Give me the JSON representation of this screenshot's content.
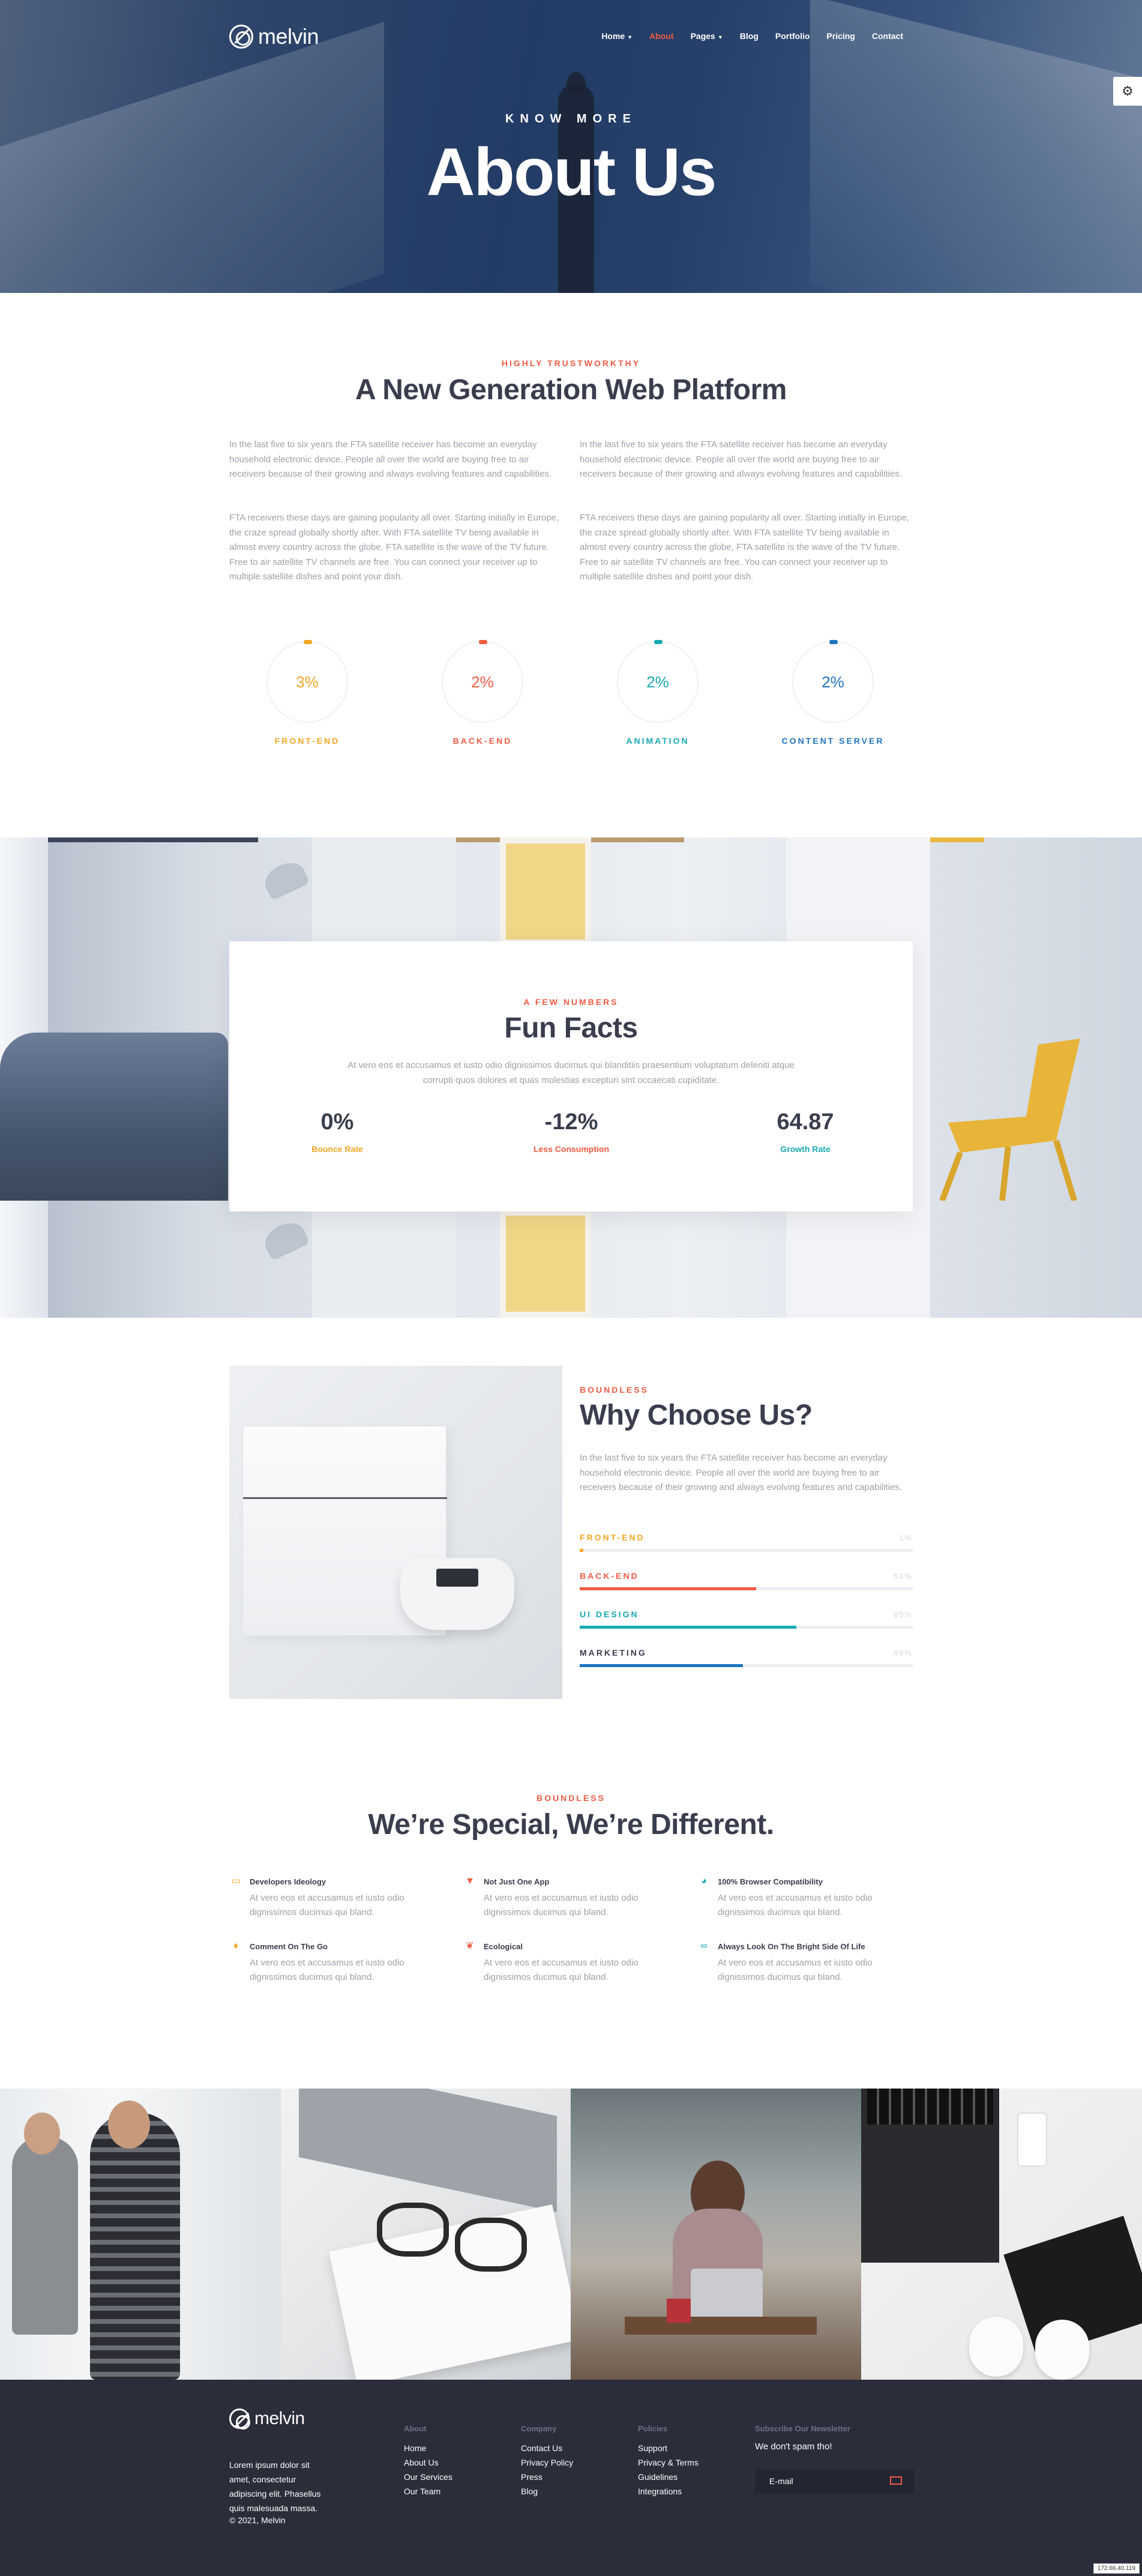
{
  "header": {
    "logo_text": "melvin",
    "nav": [
      {
        "label": "Home",
        "has_caret": true
      },
      {
        "label": "About",
        "active": true
      },
      {
        "label": "Pages",
        "has_caret": true
      },
      {
        "label": "Blog"
      },
      {
        "label": "Portfolio"
      },
      {
        "label": "Pricing"
      },
      {
        "label": "Contact"
      }
    ]
  },
  "hero": {
    "kicker": "KNOW MORE",
    "title": "About Us"
  },
  "platform": {
    "kicker": "HIGHLY TRUSTWORKTHY",
    "title": "A New Generation Web Platform",
    "col1_p1": "In the last five to six years the FTA satellite receiver has become an everyday household electronic device. People all over the world are buying free to air receivers because of their growing and always evolving features and capabilities.",
    "col1_p2": "FTA receivers these days are gaining popularity all over. Starting initially in Europe, the craze spread globally shortly after. With FTA satellite TV being available in almost every country across the globe, FTA satellite is the wave of the TV future. Free to air satellite TV channels are free. You can connect your receiver up to multiple satellite dishes and point your dish.",
    "col2_p1": "In the last five to six years the FTA satellite receiver has become an everyday household electronic device. People all over the world are buying free to air receivers because of their growing and always evolving features and capabilities.",
    "col2_p2": "FTA receivers these days are gaining popularity all over. Starting initially in Europe, the craze spread globally shortly after. With FTA satellite TV being available in almost every country across the globe, FTA satellite is the wave of the TV future. Free to air satellite TV channels are free. You can connect your receiver up to multiple satellite dishes and point your dish.",
    "rings": [
      {
        "value": "3%",
        "label": "FRONT-END",
        "color": "#f5a623"
      },
      {
        "value": "2%",
        "label": "BACK-END",
        "color": "#ef5b42"
      },
      {
        "value": "2%",
        "label": "ANIMATION",
        "color": "#17a9b2"
      },
      {
        "value": "2%",
        "label": "CONTENT SERVER",
        "color": "#1e73be"
      }
    ]
  },
  "facts": {
    "kicker": "A FEW NUMBERS",
    "title": "Fun Facts",
    "text": "At vero eos et accusamus et iusto odio dignissimos ducimus qui blanditiis praesentium voluptatum deleniti atque corrupti quos dolores et quas molestias excepturi sint occaecati cupiditate.",
    "items": [
      {
        "value": "0%",
        "label": "Bounce Rate",
        "color": "#f5a623"
      },
      {
        "value": "-12%",
        "label": "Less Consumption",
        "color": "#ef5b42"
      },
      {
        "value": "64.87",
        "label": "Growth Rate",
        "color": "#17a9b2"
      }
    ]
  },
  "why": {
    "kicker": "BOUNDLESS",
    "title": "Why Choose Us?",
    "text": "In the last five to six years the FTA satellite receiver has become an everyday household electronic device. People all over the world are buying free to air receivers because of their growing and always evolving features and capabilities.",
    "bars": [
      {
        "label": "FRONT-END",
        "pct_text": "1%",
        "fraction": 0.01,
        "color": "#f5a623"
      },
      {
        "label": "BACK-END",
        "pct_text": "53%",
        "fraction": 0.53,
        "color": "#ef5b42"
      },
      {
        "label": "UI DESIGN",
        "pct_text": "65%",
        "fraction": 0.65,
        "color": "#17a9b2"
      },
      {
        "label": "MARKETING",
        "pct_text": "49%",
        "fraction": 0.49,
        "color": "#1e73be"
      }
    ]
  },
  "special": {
    "kicker": "BOUNDLESS",
    "title": "We’re Special, We’re Different.",
    "features": [
      {
        "icon": "ticket-icon",
        "glyph": "▭",
        "color": "#f5a623",
        "title": "Developers Ideology",
        "text": "At vero eos et accusamus et iusto odio dignissimos ducimus qui bland."
      },
      {
        "icon": "bookmark-icon",
        "glyph": "▼",
        "color": "#ef5b42",
        "title": "Not Just One App",
        "text": "At vero eos et accusamus et iusto odio dignissimos ducimus qui bland."
      },
      {
        "icon": "pie-chart-icon",
        "glyph": "◕",
        "color": "#17a9b2",
        "title": "100% Browser Compatibility",
        "text": "At vero eos et accusamus et iusto odio dignissimos ducimus qui bland."
      },
      {
        "icon": "flame-icon",
        "glyph": "♦",
        "color": "#f5a623",
        "title": "Comment On The Go",
        "text": "At vero eos et accusamus et iusto odio dignissimos ducimus qui bland."
      },
      {
        "icon": "leaf-icon",
        "glyph": "❦",
        "color": "#ef5b42",
        "title": "Ecological",
        "text": "At vero eos et accusamus et iusto odio dignissimos ducimus qui bland."
      },
      {
        "icon": "binoculars-icon",
        "glyph": "∞",
        "color": "#17a9b2",
        "title": "Always Look On The Bright Side Of Life",
        "text": "At vero eos et accusamus et iusto odio dignissimos ducimus qui bland."
      }
    ]
  },
  "footer": {
    "logo_text": "melvin",
    "about_text": "Lorem ipsum dolor sit amet, consectetur adipiscing elit. Phasellus quis malesuada massa.",
    "copyright": "© 2021, Melvin",
    "columns": [
      {
        "heading": "About",
        "links": [
          "Home",
          "About Us",
          "Our Services",
          "Our Team"
        ]
      },
      {
        "heading": "Company",
        "links": [
          "Contact Us",
          "Privacy Policy",
          "Press",
          "Blog"
        ]
      },
      {
        "heading": "Policies",
        "links": [
          "Support",
          "Privacy & Terms",
          "Guidelines",
          "Integrations"
        ]
      }
    ],
    "newsletter_heading": "Subscribe Our Newsletter",
    "newsletter_tagline": "We don't spam tho!",
    "email_placeholder": "E-mail",
    "ip_badge": "172.66.40.119"
  }
}
